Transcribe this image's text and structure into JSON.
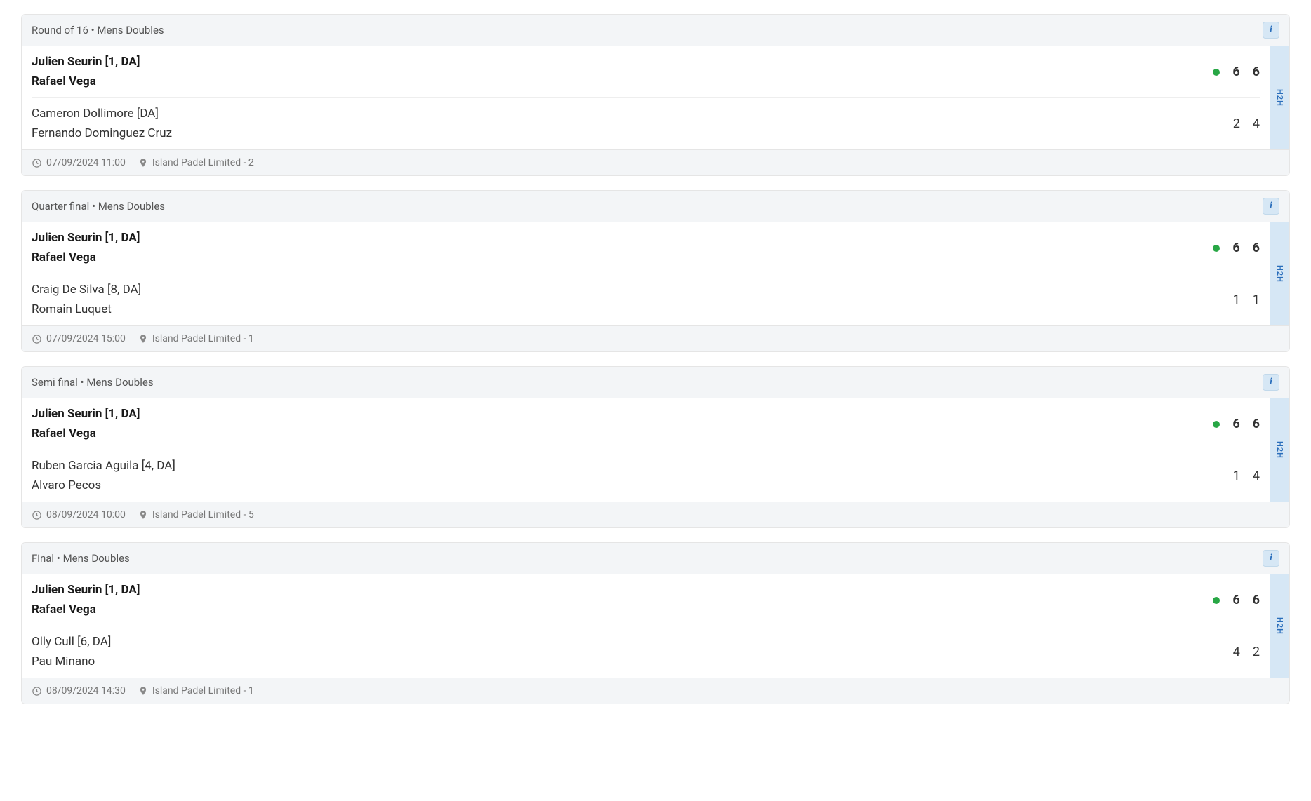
{
  "h2h_label": "H2H",
  "matches": [
    {
      "round": "Round of 16",
      "category": "Mens Doubles",
      "team1": {
        "player1": "Julien Seurin [1, DA]",
        "player2": "Rafael Vega",
        "set1": "6",
        "set2": "6",
        "winner": true
      },
      "team2": {
        "player1": "Cameron Dollimore [DA]",
        "player2": "Fernando Dominguez Cruz",
        "set1": "2",
        "set2": "4",
        "winner": false
      },
      "datetime": "07/09/2024 11:00",
      "location": "Island Padel Limited - 2"
    },
    {
      "round": "Quarter final",
      "category": "Mens Doubles",
      "team1": {
        "player1": "Julien Seurin [1, DA]",
        "player2": "Rafael Vega",
        "set1": "6",
        "set2": "6",
        "winner": true
      },
      "team2": {
        "player1": "Craig De Silva [8, DA]",
        "player2": "Romain Luquet",
        "set1": "1",
        "set2": "1",
        "winner": false
      },
      "datetime": "07/09/2024 15:00",
      "location": "Island Padel Limited - 1"
    },
    {
      "round": "Semi final",
      "category": "Mens Doubles",
      "team1": {
        "player1": "Julien Seurin [1, DA]",
        "player2": "Rafael Vega",
        "set1": "6",
        "set2": "6",
        "winner": true
      },
      "team2": {
        "player1": "Ruben Garcia Aguila [4, DA]",
        "player2": "Alvaro Pecos",
        "set1": "1",
        "set2": "4",
        "winner": false
      },
      "datetime": "08/09/2024 10:00",
      "location": "Island Padel Limited - 5"
    },
    {
      "round": "Final",
      "category": "Mens Doubles",
      "team1": {
        "player1": "Julien Seurin [1, DA]",
        "player2": "Rafael Vega",
        "set1": "6",
        "set2": "6",
        "winner": true
      },
      "team2": {
        "player1": "Olly Cull [6, DA]",
        "player2": "Pau Minano",
        "set1": "4",
        "set2": "2",
        "winner": false
      },
      "datetime": "08/09/2024 14:30",
      "location": "Island Padel Limited - 1"
    }
  ]
}
